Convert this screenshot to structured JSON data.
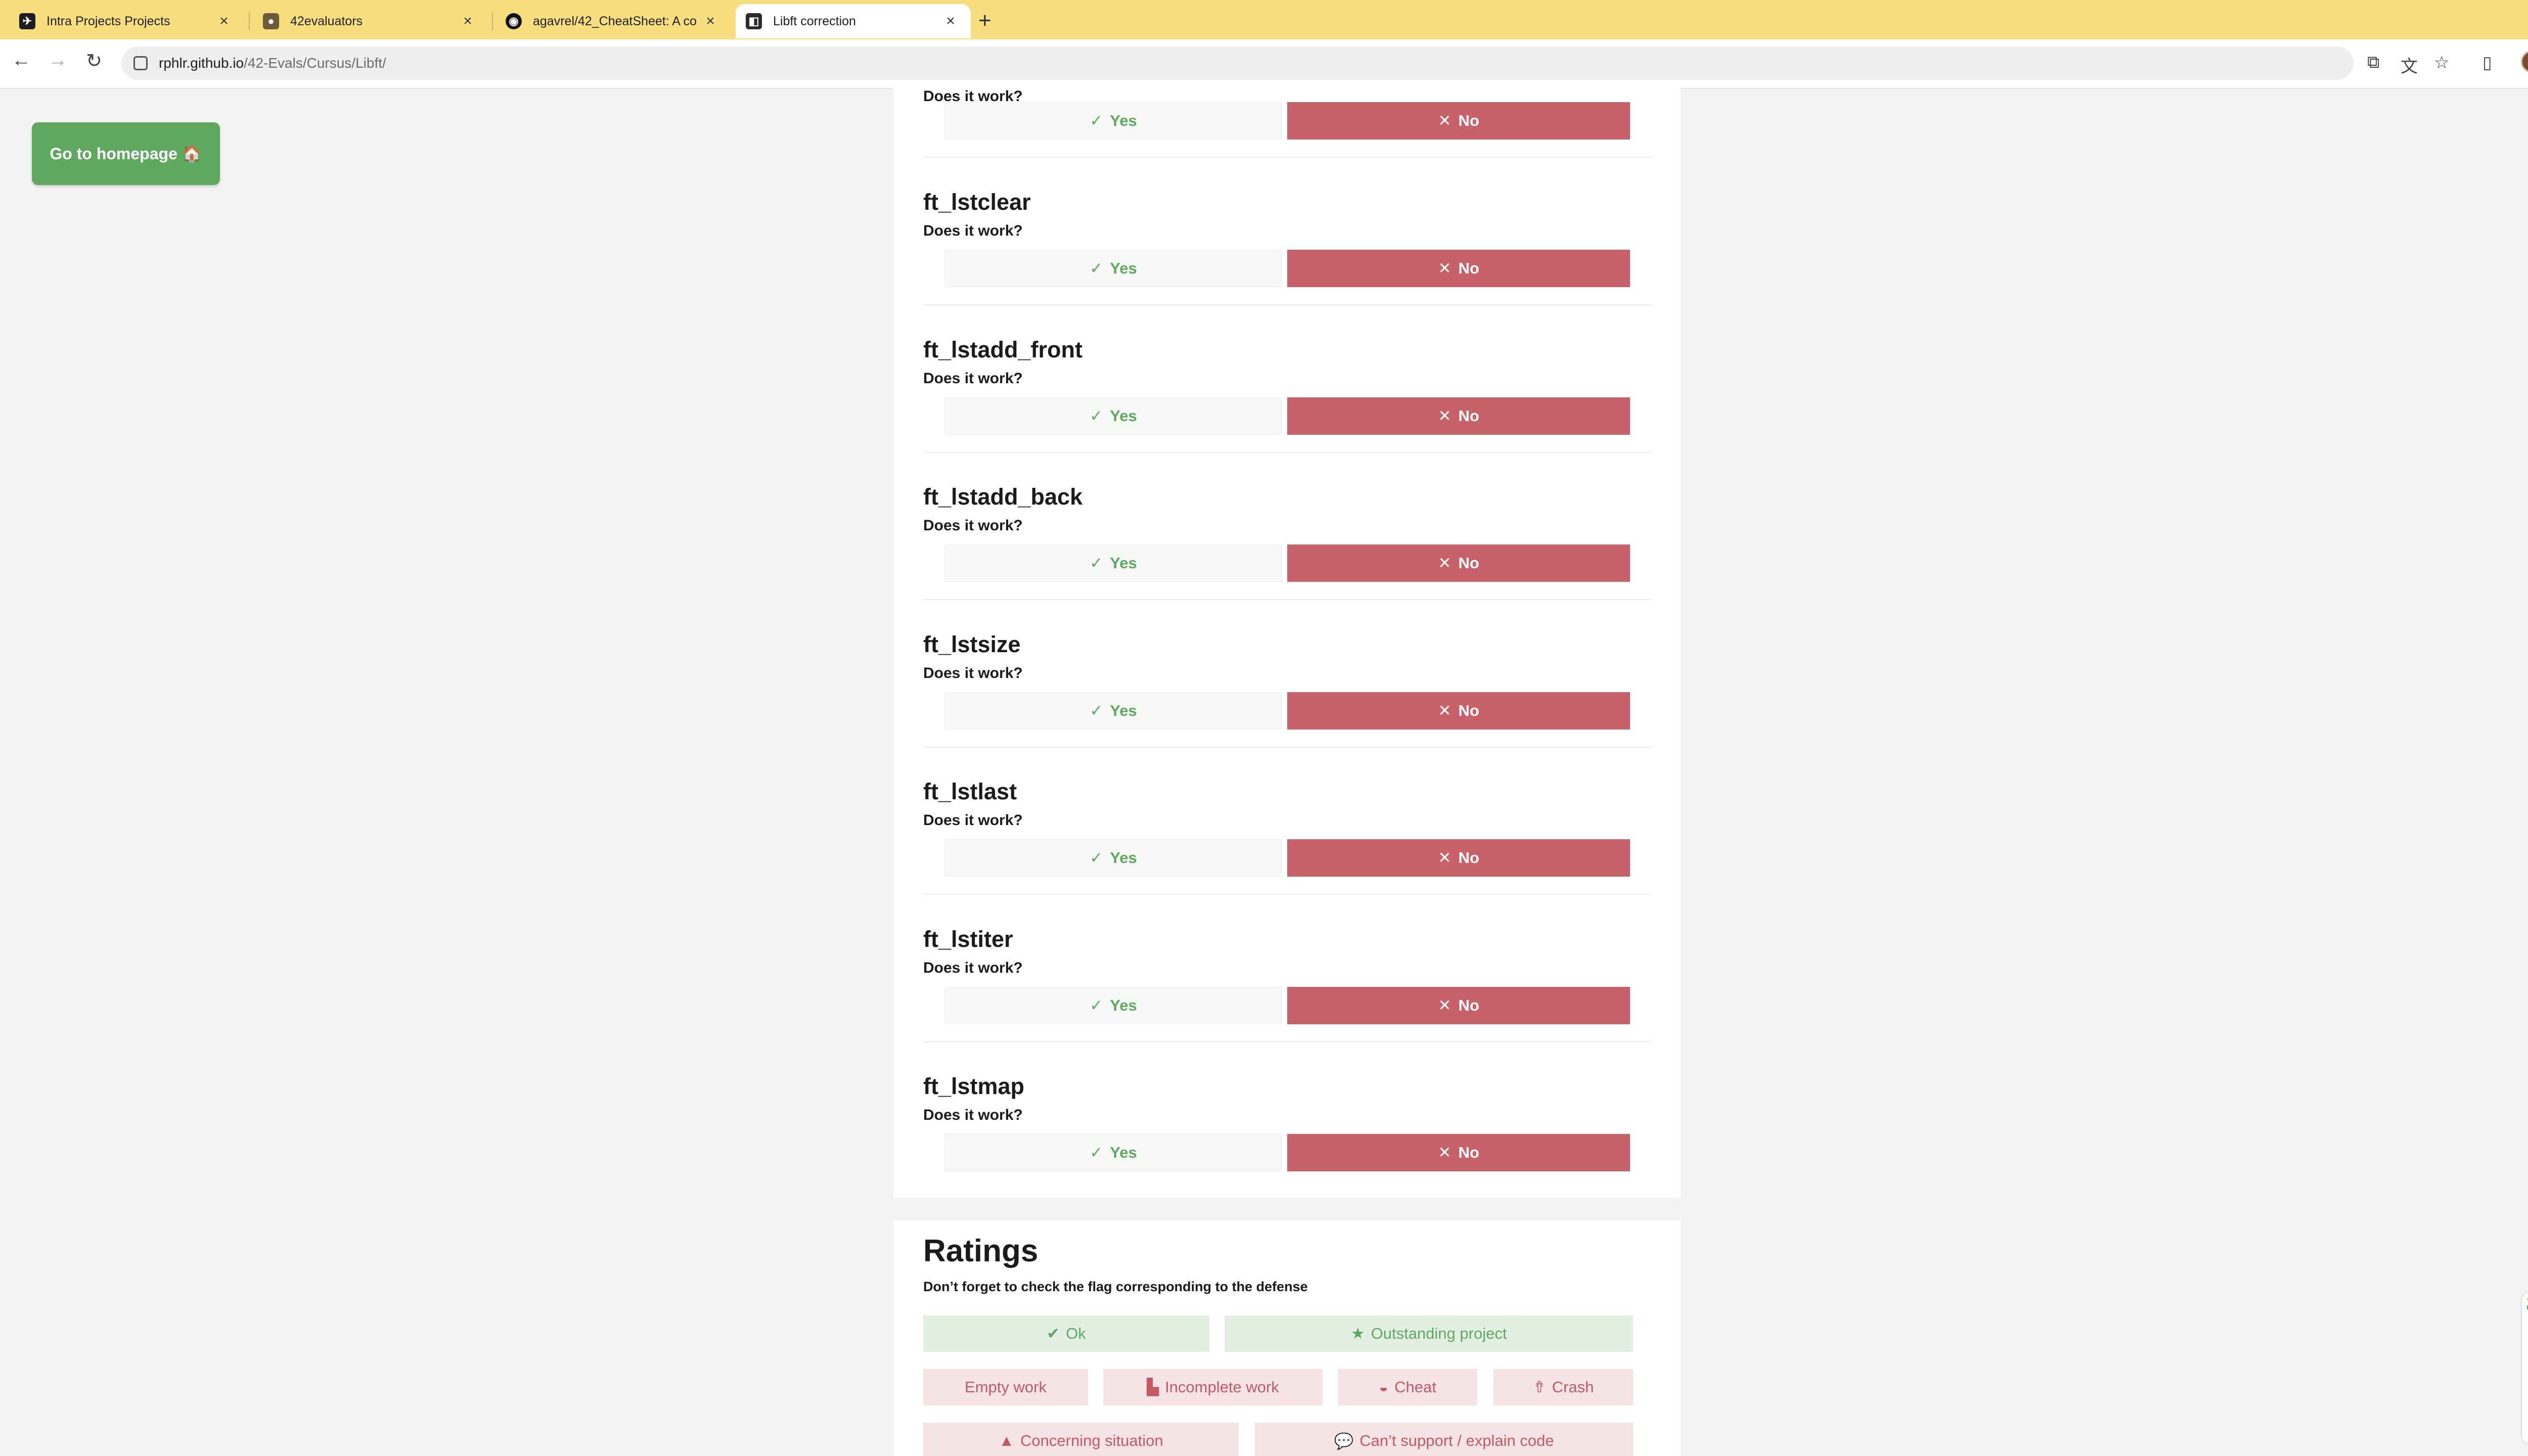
{
  "browser": {
    "tabs": [
      {
        "title": "Intra Projects Projects",
        "icon": "42-logo-icon"
      },
      {
        "title": "42evaluators",
        "icon": "user-silhouette-icon"
      },
      {
        "title": "agavrel/42_CheatSheet: A co",
        "icon": "github-icon"
      },
      {
        "title": "Libft correction",
        "icon": "page-icon"
      }
    ],
    "url_host": "rphlr.github.io",
    "url_path": "/42-Evals/Cursus/Libft/"
  },
  "page": {
    "home_button": "Go to homepage 🏠",
    "partial_question": "Does it work?",
    "yes_label": "Yes",
    "no_label": "No",
    "questions": [
      {
        "title": "ft_lstclear",
        "subtitle": "Does it work?"
      },
      {
        "title": "ft_lstadd_front",
        "subtitle": "Does it work?"
      },
      {
        "title": "ft_lstadd_back",
        "subtitle": "Does it work?"
      },
      {
        "title": "ft_lstsize",
        "subtitle": "Does it work?"
      },
      {
        "title": "ft_lstlast",
        "subtitle": "Does it work?"
      },
      {
        "title": "ft_lstiter",
        "subtitle": "Does it work?"
      },
      {
        "title": "ft_lstmap",
        "subtitle": "Does it work?"
      }
    ],
    "ratings": {
      "title": "Ratings",
      "note": "Don’t forget to check the flag corresponding to the defense",
      "buttons": {
        "ok": "Ok",
        "outstanding": "Outstanding project",
        "empty": "Empty work",
        "incomplete": "Incomplete work",
        "cheat": "Cheat",
        "crash": "Crash",
        "concerning": "Concerning situation",
        "cant_support": "Can’t support / explain code"
      }
    }
  },
  "colors": {
    "tab_bar": "#f8de7e",
    "yes_green": "#5fa85f",
    "no_red": "#c7626a",
    "bad_flag_text": "#c25a63"
  }
}
